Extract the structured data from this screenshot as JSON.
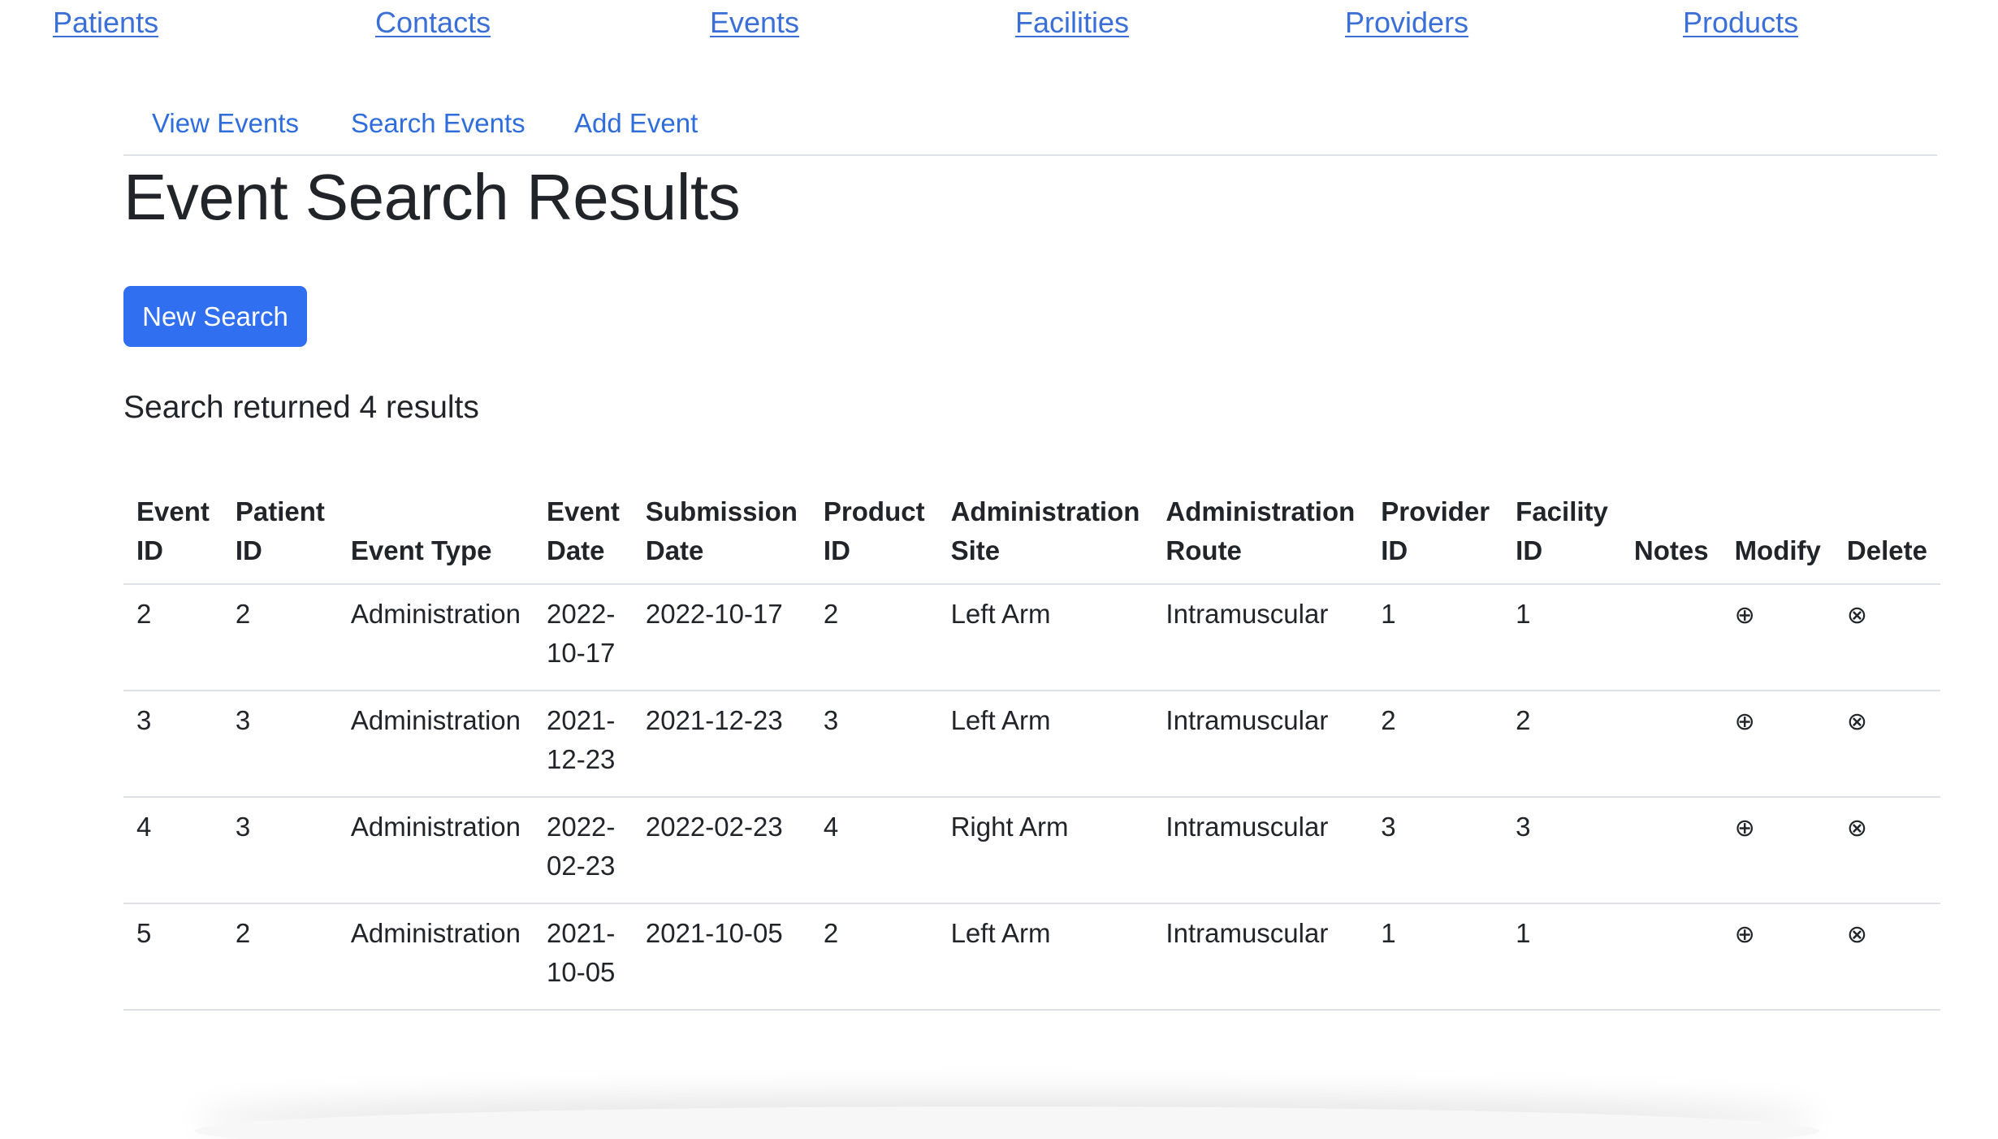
{
  "top_nav": {
    "items": [
      {
        "label": "Patients"
      },
      {
        "label": "Contacts"
      },
      {
        "label": "Events"
      },
      {
        "label": "Facilities"
      },
      {
        "label": "Providers"
      },
      {
        "label": "Products"
      }
    ]
  },
  "sub_nav": {
    "items": [
      {
        "label": "View Events"
      },
      {
        "label": "Search Events"
      },
      {
        "label": "Add Event"
      }
    ]
  },
  "page": {
    "title": "Event Search Results",
    "new_search_label": "New Search",
    "result_count_text": "Search returned 4 results"
  },
  "table": {
    "headers": {
      "event_id": [
        "Event",
        "ID"
      ],
      "patient_id": [
        "Patient",
        "ID"
      ],
      "event_type": [
        "Event Type"
      ],
      "event_date": [
        "Event",
        "Date"
      ],
      "submission_date": [
        "Submission",
        "Date"
      ],
      "product_id": [
        "Product",
        "ID"
      ],
      "administration_site": [
        "Administration",
        "Site"
      ],
      "administration_route": [
        "Administration",
        "Route"
      ],
      "provider_id": [
        "Provider",
        "ID"
      ],
      "facility_id": [
        "Facility",
        "ID"
      ],
      "notes": [
        "Notes"
      ],
      "modify": [
        "Modify"
      ],
      "delete": [
        "Delete"
      ]
    },
    "rows": [
      {
        "event_id": "2",
        "patient_id": "2",
        "event_type": "Administration",
        "event_date_line1": "2022-",
        "event_date_line2": "10-17",
        "submission_date": "2022-10-17",
        "product_id": "2",
        "administration_site": "Left Arm",
        "administration_route": "Intramuscular",
        "provider_id": "1",
        "facility_id": "1",
        "notes": "",
        "modify_icon": "⊕",
        "delete_icon": "⊗"
      },
      {
        "event_id": "3",
        "patient_id": "3",
        "event_type": "Administration",
        "event_date_line1": "2021-",
        "event_date_line2": "12-23",
        "submission_date": "2021-12-23",
        "product_id": "3",
        "administration_site": "Left Arm",
        "administration_route": "Intramuscular",
        "provider_id": "2",
        "facility_id": "2",
        "notes": "",
        "modify_icon": "⊕",
        "delete_icon": "⊗"
      },
      {
        "event_id": "4",
        "patient_id": "3",
        "event_type": "Administration",
        "event_date_line1": "2022-",
        "event_date_line2": "02-23",
        "submission_date": "2022-02-23",
        "product_id": "4",
        "administration_site": "Right Arm",
        "administration_route": "Intramuscular",
        "provider_id": "3",
        "facility_id": "3",
        "notes": "",
        "modify_icon": "⊕",
        "delete_icon": "⊗"
      },
      {
        "event_id": "5",
        "patient_id": "2",
        "event_type": "Administration",
        "event_date_line1": "2021-",
        "event_date_line2": "10-05",
        "submission_date": "2021-10-05",
        "product_id": "2",
        "administration_site": "Left Arm",
        "administration_route": "Intramuscular",
        "provider_id": "1",
        "facility_id": "1",
        "notes": "",
        "modify_icon": "⊕",
        "delete_icon": "⊗"
      }
    ]
  },
  "icons": {
    "modify": "circled-plus-icon",
    "delete": "circled-times-icon"
  },
  "colors": {
    "link": "#3a6fd8",
    "primary_button": "#2f6ff0",
    "text": "#212529",
    "border": "#dee2e6"
  }
}
